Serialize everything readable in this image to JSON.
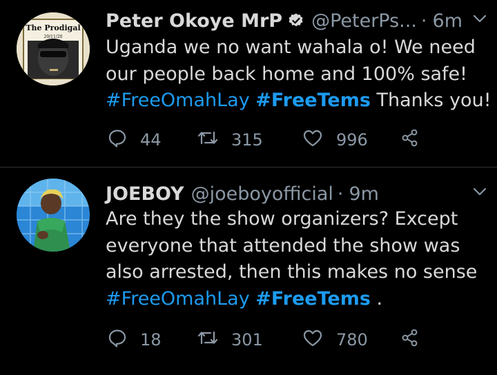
{
  "tweets": [
    {
      "name": "Peter Okoye MrP",
      "handle": "@PeterPs...",
      "time": "6m",
      "avatar_text": "The Prodigal",
      "avatar_subtext": "20/11/20",
      "lines": [
        "Uganda we no want wahala o! We need",
        "our people back home and 100% safe!"
      ],
      "hashtag1": "#FreeOmahLay",
      "hashtag2": "#FreeTems",
      "tail": "Thanks you!",
      "replies": "44",
      "retweets": "315",
      "likes": "996"
    },
    {
      "name": "JOEBOY",
      "handle": "@joeboyofficial",
      "time": "9m",
      "lines": [
        "Are they the show organizers? Except",
        "everyone that attended the show was",
        "also arrested, then this makes no sense"
      ],
      "hashtag1": "#FreeOmahLay",
      "hashtag2": "#FreeTems",
      "tail": ".",
      "replies": "18",
      "retweets": "301",
      "likes": "780"
    }
  ],
  "colors": {
    "background": "#000000",
    "text": "#d9d9d9",
    "muted": "#8b98a5",
    "link": "#1d9bf0"
  },
  "icons": [
    "verified-badge-icon",
    "chevron-down-icon",
    "reply-icon",
    "retweet-icon",
    "like-icon",
    "share-icon"
  ]
}
